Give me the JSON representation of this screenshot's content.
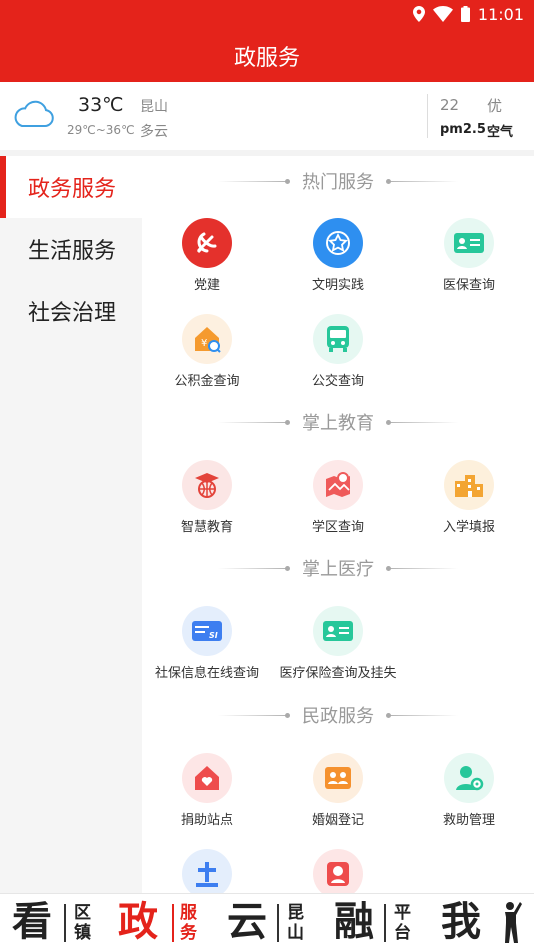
{
  "status_bar": {
    "time": "11:01"
  },
  "header": {
    "title": "政服务"
  },
  "weather": {
    "temperature": "33℃",
    "temp_range": "29℃~36℃",
    "city": "昆山",
    "condition": "多云",
    "aqi_value": "22",
    "aqi_level": "优",
    "pm_label": "pm2.5",
    "air_label": "空气"
  },
  "sidebar": {
    "items": [
      {
        "label": "政务服务"
      },
      {
        "label": "生活服务"
      },
      {
        "label": "社会治理"
      }
    ]
  },
  "sections": [
    {
      "title": "热门服务",
      "items": [
        {
          "label": "党建",
          "icon": "party-emblem-icon",
          "color": "#e4312c"
        },
        {
          "label": "文明实践",
          "icon": "flower-badge-icon",
          "color": "#2e8ff0"
        },
        {
          "label": "医保查询",
          "icon": "id-card-icon",
          "color": "#27c79a"
        },
        {
          "label": "公积金查询",
          "icon": "house-fund-icon",
          "color": "#f59a2e"
        },
        {
          "label": "公交查询",
          "icon": "bus-icon",
          "color": "#27c79a"
        }
      ]
    },
    {
      "title": "掌上教育",
      "items": [
        {
          "label": "智慧教育",
          "icon": "graduation-globe-icon",
          "color": "#e3433a"
        },
        {
          "label": "学区查询",
          "icon": "map-location-icon",
          "color": "#ef5a5a"
        },
        {
          "label": "入学填报",
          "icon": "school-buildings-icon",
          "color": "#f3a533"
        }
      ]
    },
    {
      "title": "掌上医疗",
      "items": [
        {
          "label": "社保信息在线查询",
          "icon": "social-security-card-icon",
          "color": "#3d7ef0"
        },
        {
          "label": "医疗保险查询及挂失",
          "icon": "id-card-icon",
          "color": "#27c79a"
        }
      ]
    },
    {
      "title": "民政服务",
      "items": [
        {
          "label": "捐助站点",
          "icon": "heart-house-icon",
          "color": "#ee4c4c"
        },
        {
          "label": "婚姻登记",
          "icon": "marriage-certificate-icon",
          "color": "#f5912e"
        },
        {
          "label": "救助管理",
          "icon": "person-gear-icon",
          "color": "#27c79a"
        },
        {
          "label": "",
          "icon": "cemetery-icon",
          "color": "#3d7ef0"
        },
        {
          "label": "",
          "icon": "elder-care-icon",
          "color": "#ee4c4c"
        }
      ]
    }
  ],
  "bottom_nav": [
    {
      "big": "看",
      "small1": "区",
      "small2": "镇"
    },
    {
      "big": "政",
      "small1": "服",
      "small2": "务"
    },
    {
      "big": "云",
      "small1": "昆",
      "small2": "山"
    },
    {
      "big": "融",
      "small1": "平",
      "small2": "台"
    },
    {
      "big": "我"
    }
  ],
  "colors": {
    "brand_red": "#e4231b"
  }
}
